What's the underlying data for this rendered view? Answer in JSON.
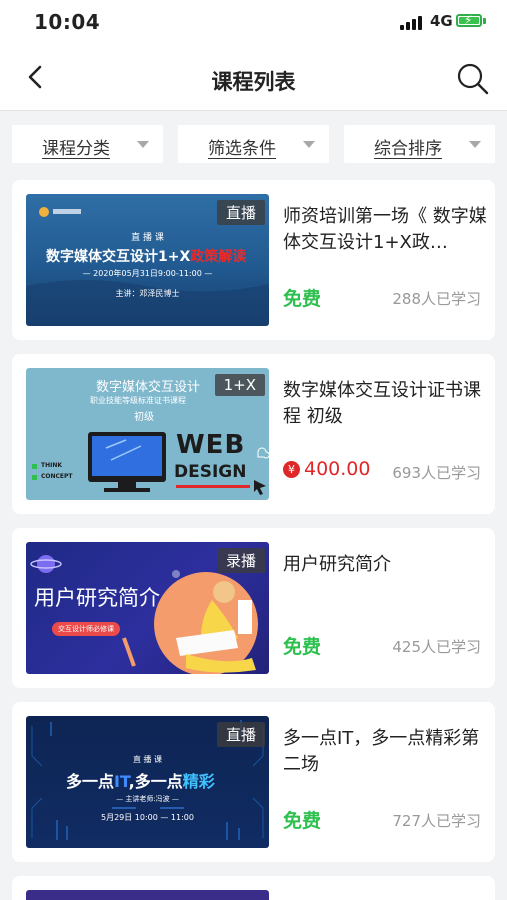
{
  "status": {
    "time": "10:04",
    "network": "4G"
  },
  "nav": {
    "title": "课程列表"
  },
  "filters": [
    {
      "label": "课程分类"
    },
    {
      "label": "筛选条件"
    },
    {
      "label": "综合排序"
    }
  ],
  "courses": [
    {
      "tag": "直播",
      "title": "师资培训第一场《 数字媒体交互设计1+X政…",
      "price": "免费",
      "students": "288人已学习",
      "thumb": {
        "kicker": "直 播 课",
        "headline": "数字媒体交互设计1+X",
        "headline_accent": "政策解读",
        "date": "— 2020年05月31日9:00-11:00 —",
        "speaker": "主讲：邓泽民博士"
      }
    },
    {
      "tag": "1+X",
      "title": "数字媒体交互设计证书课程 初级",
      "price": "400.00",
      "price_symbol": "¥",
      "students": "693人已学习",
      "thumb": {
        "headline": "数字媒体交互设计",
        "sub": "职业技能等级标准证书课程",
        "level": "初级",
        "web": "WEB",
        "design": "DESIGN",
        "think": "THINK",
        "concept": "CONCEPT"
      }
    },
    {
      "tag": "录播",
      "title": "用户研究简介",
      "price": "免费",
      "students": "425人已学习",
      "thumb": {
        "headline": "用户研究简介",
        "badge": "交互设计师必修课"
      }
    },
    {
      "tag": "直播",
      "title": "多一点IT，多一点精彩第二场",
      "price": "免费",
      "students": "727人已学习",
      "thumb": {
        "kicker": "直 播 课",
        "headline_a": "多一点",
        "headline_it": "IT",
        "headline_b": ",多一点",
        "headline_accent": "精彩",
        "speaker": "— 主讲老师:冯波 —",
        "date": "5月29日 10:00 — 11:00"
      }
    }
  ],
  "colors": {
    "free": "#2ec04f",
    "paid": "#e02828",
    "accent_live": "#3f8cff"
  }
}
